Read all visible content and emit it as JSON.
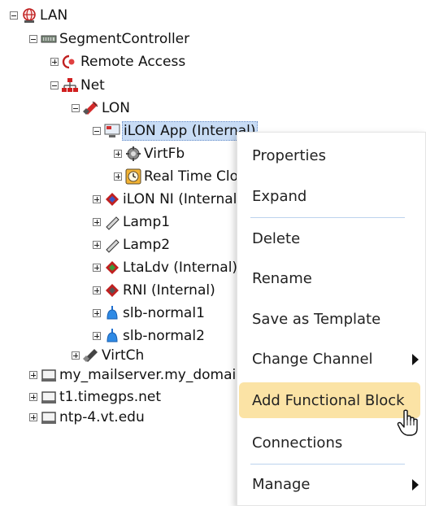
{
  "tree": {
    "lan": "LAN",
    "segment_controller": "SegmentController",
    "remote_access": "Remote Access",
    "net": "Net",
    "lon": "LON",
    "ilon_app": "iLON App (Internal)",
    "virtfb": "VirtFb",
    "real_time": "Real Time Clock",
    "ilon_ni": "iLON NI (Internal)",
    "lamp1": "Lamp1",
    "lamp2": "Lamp2",
    "ltaldv": "LtaLdv (Internal)",
    "rni": "RNI (Internal)",
    "slb_normal1": "slb-normal1",
    "slb_normal2": "slb-normal2",
    "virtch": "VirtCh",
    "mailserver": "my_mailserver.my_domain",
    "timegps": "t1.timegps.net",
    "ntp": "ntp-4.vt.edu"
  },
  "context_menu": {
    "properties": "Properties",
    "expand": "Expand",
    "delete": "Delete",
    "rename": "Rename",
    "save_as_template": "Save as Template",
    "change_channel": "Change Channel",
    "add_functional_block": "Add Functional Block",
    "connections": "Connections",
    "manage": "Manage"
  },
  "colors": {
    "selection": "#c8dcf5",
    "menu_hover": "#fbe3a5",
    "separator": "#bcd3ee"
  }
}
